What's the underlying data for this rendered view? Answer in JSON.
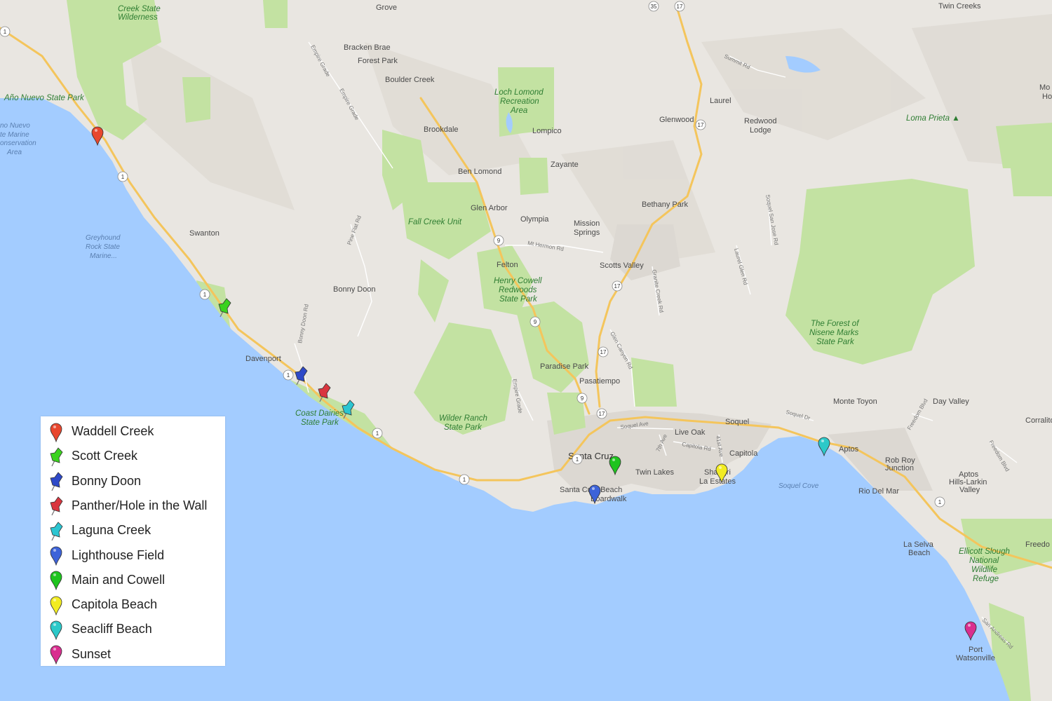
{
  "places": [
    {
      "name": "Creek State",
      "kind": "park"
    },
    {
      "name": "Wilderness",
      "kind": "park"
    },
    {
      "name": "Año Nuevo State Park",
      "kind": "park"
    },
    {
      "name": "no Nuevo",
      "kind": "water"
    },
    {
      "name": "te Marine",
      "kind": "water"
    },
    {
      "name": "onservation",
      "kind": "water"
    },
    {
      "name": "Area",
      "kind": "water"
    },
    {
      "name": "Greyhound",
      "kind": "water"
    },
    {
      "name": "Rock State",
      "kind": "water"
    },
    {
      "name": "Marine...",
      "kind": "water"
    },
    {
      "name": "Swanton",
      "kind": "place"
    },
    {
      "name": "Bonny Doon",
      "kind": "place"
    },
    {
      "name": "Davenport",
      "kind": "place"
    },
    {
      "name": "Coast Dairies",
      "kind": "park"
    },
    {
      "name": "State Park",
      "kind": "park"
    },
    {
      "name": "Wilder Ranch",
      "kind": "park"
    },
    {
      "name": "State Park",
      "kind": "park"
    },
    {
      "name": "Bracken Brae",
      "kind": "place"
    },
    {
      "name": "Forest Park",
      "kind": "place"
    },
    {
      "name": "Boulder Creek",
      "kind": "place"
    },
    {
      "name": "Brookdale",
      "kind": "place"
    },
    {
      "name": "Ben Lomond",
      "kind": "place"
    },
    {
      "name": "Glen Arbor",
      "kind": "place"
    },
    {
      "name": "Fall Creek Unit",
      "kind": "park"
    },
    {
      "name": "Loch Lomond",
      "kind": "park"
    },
    {
      "name": "Recreation",
      "kind": "park"
    },
    {
      "name": "Area",
      "kind": "park"
    },
    {
      "name": "Lompico",
      "kind": "place"
    },
    {
      "name": "Zayante",
      "kind": "place"
    },
    {
      "name": "Olympia",
      "kind": "place"
    },
    {
      "name": "Felton",
      "kind": "place"
    },
    {
      "name": "Henry Cowell",
      "kind": "park"
    },
    {
      "name": "Redwoods",
      "kind": "park"
    },
    {
      "name": "State Park",
      "kind": "park"
    },
    {
      "name": "Mission",
      "kind": "place"
    },
    {
      "name": "Springs",
      "kind": "place"
    },
    {
      "name": "Scotts Valley",
      "kind": "place"
    },
    {
      "name": "Paradise Park",
      "kind": "place"
    },
    {
      "name": "Pasatiempo",
      "kind": "place"
    },
    {
      "name": "Santa Cruz",
      "kind": "city"
    },
    {
      "name": "Twin Lakes",
      "kind": "place"
    },
    {
      "name": "Santa Cruz Beach",
      "kind": "place"
    },
    {
      "name": "Boardwalk",
      "kind": "place"
    },
    {
      "name": "Live Oak",
      "kind": "place"
    },
    {
      "name": "Soquel",
      "kind": "place"
    },
    {
      "name": "Capitola",
      "kind": "place"
    },
    {
      "name": "Shangri",
      "kind": "place"
    },
    {
      "name": "La Estates",
      "kind": "place"
    },
    {
      "name": "Laurel",
      "kind": "place"
    },
    {
      "name": "Glenwood",
      "kind": "place"
    },
    {
      "name": "Redwood",
      "kind": "place"
    },
    {
      "name": "Lodge",
      "kind": "place"
    },
    {
      "name": "Bethany Park",
      "kind": "place"
    },
    {
      "name": "Loma Prieta ▲",
      "kind": "park"
    },
    {
      "name": "The Forest of",
      "kind": "park"
    },
    {
      "name": "Nisene Marks",
      "kind": "park"
    },
    {
      "name": "State Park",
      "kind": "park"
    },
    {
      "name": "Monte Toyon",
      "kind": "place"
    },
    {
      "name": "Day Valley",
      "kind": "place"
    },
    {
      "name": "Corralitos",
      "kind": "place"
    },
    {
      "name": "Aptos",
      "kind": "place"
    },
    {
      "name": "Rob Roy",
      "kind": "place"
    },
    {
      "name": "Junction",
      "kind": "place"
    },
    {
      "name": "Rio Del Mar",
      "kind": "place"
    },
    {
      "name": "Aptos",
      "kind": "place"
    },
    {
      "name": "Hills-Larkin",
      "kind": "place"
    },
    {
      "name": "Valley",
      "kind": "place"
    },
    {
      "name": "Soquel Cove",
      "kind": "water"
    },
    {
      "name": "La Selva",
      "kind": "place"
    },
    {
      "name": "Beach",
      "kind": "place"
    },
    {
      "name": "Ellicott Slough",
      "kind": "park"
    },
    {
      "name": "National",
      "kind": "park"
    },
    {
      "name": "Wildlife",
      "kind": "park"
    },
    {
      "name": "Refuge",
      "kind": "park"
    },
    {
      "name": "Freedo",
      "kind": "place"
    },
    {
      "name": "Port",
      "kind": "place"
    },
    {
      "name": "Watsonville",
      "kind": "place"
    },
    {
      "name": "Grove",
      "kind": "place"
    },
    {
      "name": "Twin Creeks",
      "kind": "place"
    },
    {
      "name": "Mo",
      "kind": "place"
    },
    {
      "name": "Ho",
      "kind": "place"
    }
  ],
  "roads": [
    {
      "name": "Empire Grade"
    },
    {
      "name": "Empire Grade"
    },
    {
      "name": "Pine Flat Rd"
    },
    {
      "name": "Bonny Doon Rd"
    },
    {
      "name": "Empire Grade"
    },
    {
      "name": "Mt Hermon Rd"
    },
    {
      "name": "Glen Canyon Rd"
    },
    {
      "name": "Granite Creek Rd"
    },
    {
      "name": "Laurel Glen Rd"
    },
    {
      "name": "Soquel San Jose Rd"
    },
    {
      "name": "Summit Rd"
    },
    {
      "name": "Soquel Ave"
    },
    {
      "name": "Capitola Rd"
    },
    {
      "name": "7th Ave"
    },
    {
      "name": "41st Ave"
    },
    {
      "name": "Soquel Dr"
    },
    {
      "name": "Freedom Blvd"
    },
    {
      "name": "Freedom Blvd"
    },
    {
      "name": "San Andreas Rd"
    }
  ],
  "shields": [
    {
      "num": "1"
    },
    {
      "num": "1"
    },
    {
      "num": "1"
    },
    {
      "num": "1"
    },
    {
      "num": "1"
    },
    {
      "num": "1"
    },
    {
      "num": "1"
    },
    {
      "num": "1"
    },
    {
      "num": "9"
    },
    {
      "num": "9"
    },
    {
      "num": "9"
    },
    {
      "num": "17"
    },
    {
      "num": "17"
    },
    {
      "num": "17"
    },
    {
      "num": "17"
    },
    {
      "num": "17"
    },
    {
      "num": "35"
    }
  ],
  "markers": [
    {
      "name": "Waddell Creek",
      "color": "#e8472e",
      "type": "balloon"
    },
    {
      "name": "Scott Creek",
      "color": "#3bd21f",
      "type": "pushpin"
    },
    {
      "name": "Bonny Doon",
      "color": "#2e49c8",
      "type": "pushpin"
    },
    {
      "name": "Panther/Hole in the Wall",
      "color": "#d9363f",
      "type": "pushpin"
    },
    {
      "name": "Laguna Creek",
      "color": "#2cc5d1",
      "type": "pushpin"
    },
    {
      "name": "Lighthouse Field",
      "color": "#3d63d9",
      "type": "balloon"
    },
    {
      "name": "Main and Cowell",
      "color": "#1ec41e",
      "type": "balloon"
    },
    {
      "name": "Capitola Beach",
      "color": "#f2ec22",
      "type": "balloon"
    },
    {
      "name": "Seacliff Beach",
      "color": "#2cc9c9",
      "type": "balloon"
    },
    {
      "name": "Sunset",
      "color": "#d92e8f",
      "type": "balloon"
    }
  ],
  "legend": {
    "items": [
      {
        "label": "Waddell Creek",
        "color": "#e8472e",
        "type": "balloon"
      },
      {
        "label": "Scott Creek",
        "color": "#3bd21f",
        "type": "pushpin"
      },
      {
        "label": "Bonny Doon",
        "color": "#2e49c8",
        "type": "pushpin"
      },
      {
        "label": "Panther/Hole in the Wall",
        "color": "#d9363f",
        "type": "pushpin"
      },
      {
        "label": "Laguna Creek",
        "color": "#2cc5d1",
        "type": "pushpin"
      },
      {
        "label": "Lighthouse Field",
        "color": "#3d63d9",
        "type": "balloon"
      },
      {
        "label": "Main and Cowell",
        "color": "#1ec41e",
        "type": "balloon"
      },
      {
        "label": "Capitola Beach",
        "color": "#f2ec22",
        "type": "balloon"
      },
      {
        "label": "Seacliff Beach",
        "color": "#2cc9c9",
        "type": "balloon"
      },
      {
        "label": "Sunset",
        "color": "#d92e8f",
        "type": "balloon"
      }
    ]
  },
  "colors": {
    "ocean": "#a3ccff",
    "land": "#e9e6e1",
    "park": "#c3e2a2",
    "urban": "#dcd8d2",
    "highway": "#f4c55c",
    "road": "#ffffff",
    "lake": "#a3ccff"
  }
}
